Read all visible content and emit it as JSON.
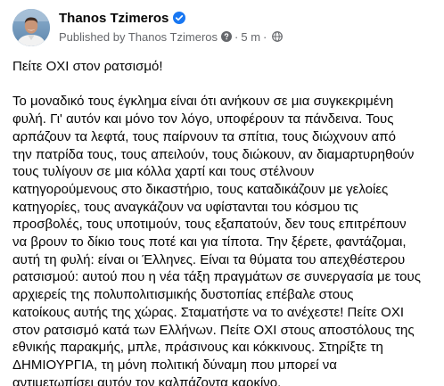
{
  "author": {
    "name": "Thanos Tzimeros",
    "published_by": "Published by Thanos Tzimeros",
    "time": "5 m",
    "separator": "·"
  },
  "icons": {
    "verified": "verified-badge-icon",
    "help": "question-mark-icon",
    "audience": "globe-icon"
  },
  "colors": {
    "verified_blue": "#1877f2",
    "secondary_text": "#65676b",
    "primary_text": "#050505"
  },
  "post": {
    "heading": "Πείτε ΟΧΙ στον ρατσισμό!",
    "body_lines": [
      "Το μοναδικό τους έγκλημα είναι ότι ανήκουν σε μια συγκεκριμένη",
      "φυλή. Γι' αυτόν και μόνο τον λόγο, υποφέρουν τα πάνδεινα. Τους",
      "αρπάζουν τα λεφτά, τους παίρνουν τα σπίτια, τους διώχνουν από",
      "την πατρίδα τους, τους απειλούν, τους διώκουν, αν διαμαρτυρηθούν",
      "τους τυλίγουν σε μια κόλλα χαρτί και τους στέλνουν",
      "κατηγορούμενους στο δικαστήριο, τους καταδικάζουν με γελοίες",
      "κατηγορίες, τους αναγκάζουν να υφίστανται του κόσμου τις",
      "προσβολές, τους υποτιμούν, τους εξαπατούν, δεν τους επιτρέπουν",
      "να βρουν το δίκιο τους ποτέ και για τίποτα. Την ξέρετε, φαντάζομαι,",
      "αυτή τη φυλή: είναι οι Έλληνες. Είναι τα θύματα του απεχθέστερου",
      "ρατσισμού: αυτού που η νέα τάξη πραγμάτων σε συνεργασία με τους",
      "αρχιερείς της πολυπολιτισμικής δυστοπίας επέβαλε στους",
      "κατοίκους αυτής της χώρας. Σταματήστε να το ανέχεστε! Πείτε ΟΧΙ",
      "στον ρατσισμό κατά των Ελλήνων. Πείτε ΟΧΙ στους αποστόλους της",
      "εθνικής παρακμής, μπλε, πράσινους και κόκκινους. Στηρίξτε τη",
      "ΔΗΜΙΟΥΡΓΙΑ, τη μόνη πολιτική δύναμη που μπορεί να",
      "αντιμετωπίσει αυτόν τον καλπάζοντα καρκίνο."
    ]
  }
}
